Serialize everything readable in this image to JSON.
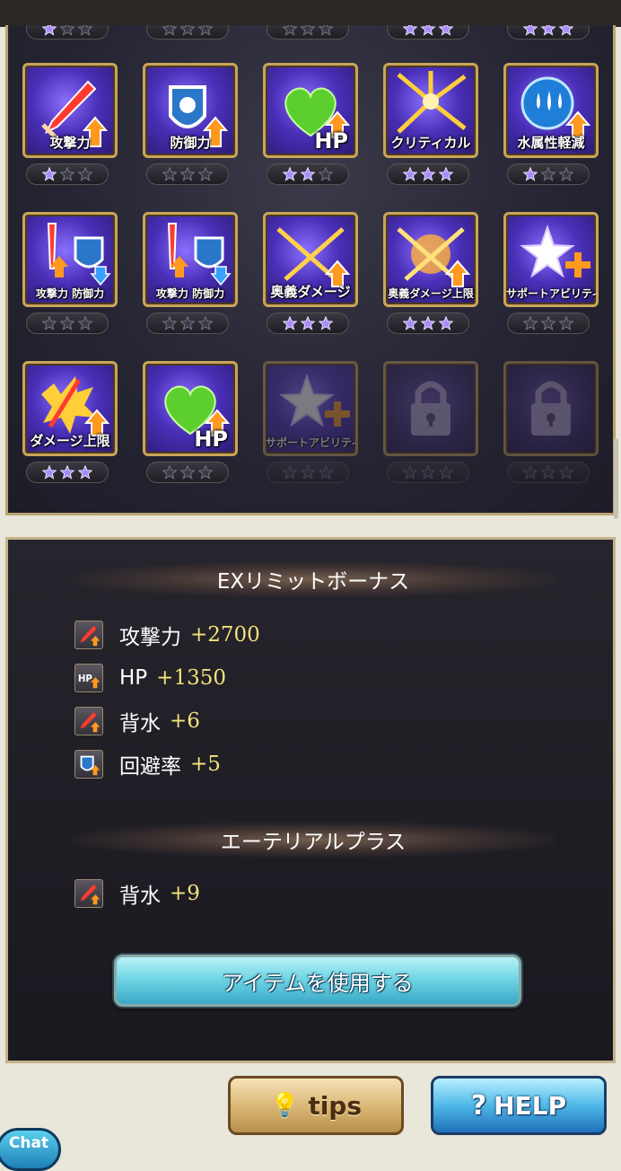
{
  "grid": {
    "top_star_rows": [
      {
        "filled": 1
      },
      {
        "filled": 0
      },
      {
        "filled": 0
      },
      {
        "filled": 3
      },
      {
        "filled": 3
      }
    ],
    "tiles": [
      {
        "label": "攻撃力",
        "icon": "sword-up-icon",
        "filled": 1,
        "state": "active"
      },
      {
        "label": "防御力",
        "icon": "shield-up-icon",
        "filled": 0,
        "state": "active"
      },
      {
        "label": "HP",
        "icon": "heart-up-icon",
        "filled": 2,
        "state": "active"
      },
      {
        "label": "クリティカル",
        "icon": "critical-burst-icon",
        "filled": 3,
        "state": "active"
      },
      {
        "label": "水属性軽減",
        "icon": "water-resist-icon",
        "filled": 1,
        "state": "active"
      },
      {
        "label": "攻撃力 防御力",
        "icon": "atk-up-def-down-icon",
        "filled": 0,
        "state": "active"
      },
      {
        "label": "攻撃力 防御力",
        "icon": "atk-up-def-down-icon",
        "filled": 0,
        "state": "active"
      },
      {
        "label": "奥義ダメージ",
        "icon": "crossed-swords-icon",
        "filled": 3,
        "state": "active"
      },
      {
        "label": "奥義ダメージ上限",
        "icon": "burst-swords-icon",
        "filled": 3,
        "state": "active"
      },
      {
        "label": "サポートアビリティ",
        "icon": "star-plus-icon",
        "filled": 0,
        "state": "active"
      },
      {
        "label": "ダメージ上限",
        "icon": "damage-cap-icon",
        "filled": 3,
        "state": "active"
      },
      {
        "label": "HP",
        "icon": "heart-up-icon",
        "filled": 0,
        "state": "active"
      },
      {
        "label": "サポートアビリティ",
        "icon": "star-plus-icon",
        "filled": 0,
        "state": "dim"
      },
      {
        "label": "",
        "icon": "padlock-icon",
        "filled": 0,
        "state": "locked"
      },
      {
        "label": "",
        "icon": "padlock-icon",
        "filled": 0,
        "state": "locked"
      }
    ]
  },
  "ex_limit": {
    "title": "EXリミットボーナス",
    "items": [
      {
        "name": "攻撃力",
        "value": "+2700",
        "icon": "sword-up-icon"
      },
      {
        "name": "HP",
        "value": "+1350",
        "icon": "hp-up-icon"
      },
      {
        "name": "背水",
        "value": "+6",
        "icon": "sword-up-icon"
      },
      {
        "name": "回避率",
        "value": "+5",
        "icon": "dodge-up-icon"
      }
    ]
  },
  "ethereal": {
    "title": "エーテリアルプラス",
    "items": [
      {
        "name": "背水",
        "value": "+9",
        "icon": "sword-up-icon"
      }
    ]
  },
  "use_item_label": "アイテムを使用する",
  "footer": {
    "tips_label": "tips",
    "help_label": "HELP",
    "chat_label": "Chat"
  }
}
